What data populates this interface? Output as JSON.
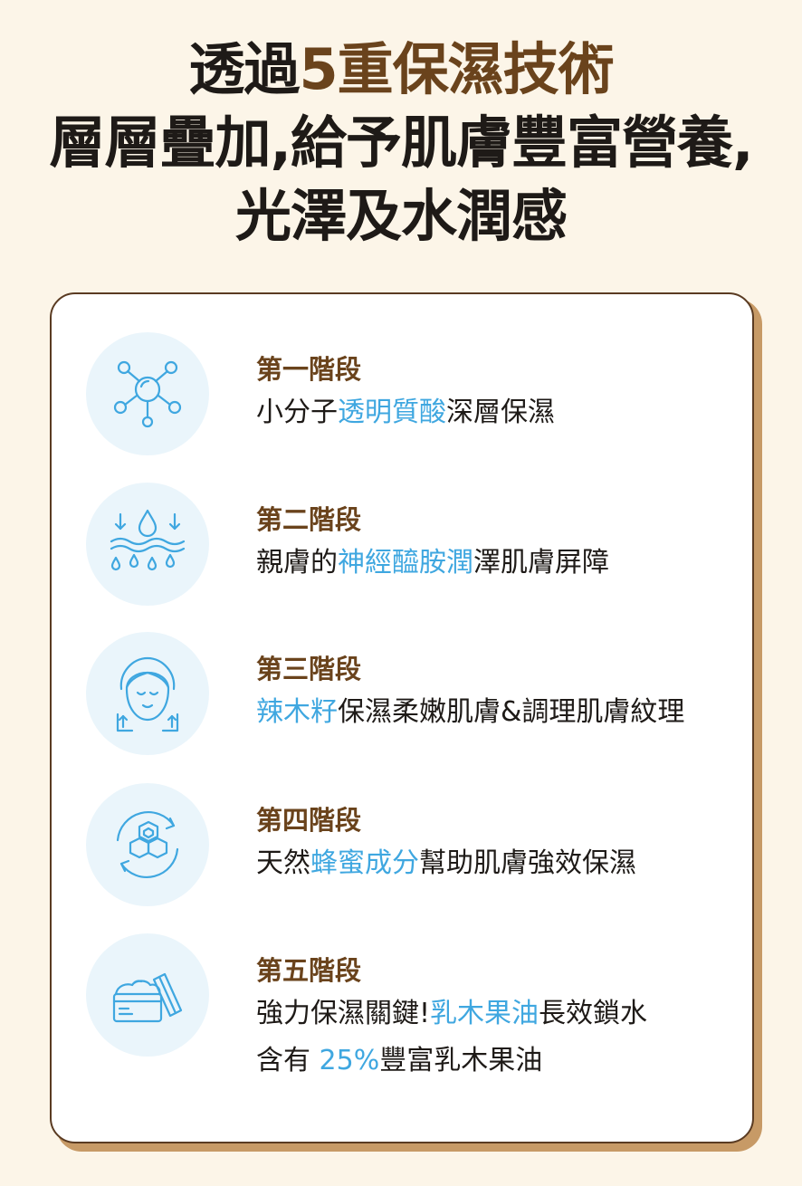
{
  "headline": {
    "line1_part1": "透過",
    "line1_accent": "5重保濕技術",
    "line2": "層層疊加,給予肌膚豐富營養,",
    "line3": "光澤及水潤感"
  },
  "accent_color": "#6a431c",
  "highlight_color": "#3fa7e0",
  "stages": [
    {
      "title": "第一階段",
      "icon": "molecule-icon",
      "desc_before": "小分子",
      "desc_highlight": "透明質酸",
      "desc_after": "深層保濕"
    },
    {
      "title": "第二階段",
      "icon": "water-drops-icon",
      "desc_before": "親膚的",
      "desc_highlight": "神經醯胺潤",
      "desc_after": "澤肌膚屏障"
    },
    {
      "title": "第三階段",
      "icon": "face-care-icon",
      "desc_before": "",
      "desc_highlight": "辣木籽",
      "desc_after": "保濕柔嫩肌膚&調理肌膚紋理"
    },
    {
      "title": "第四階段",
      "icon": "honeycomb-icon",
      "desc_before": "天然",
      "desc_highlight": "蜂蜜成分",
      "desc_after": "幫助肌膚強效保濕"
    },
    {
      "title": "第五階段",
      "icon": "cream-jar-icon",
      "desc_before": "強力保濕關鍵!",
      "desc_highlight": "乳木果油",
      "desc_after": "長效鎖水",
      "line2_before": "含有 ",
      "line2_highlight": "25%",
      "line2_after": "豐富乳木果油"
    }
  ]
}
